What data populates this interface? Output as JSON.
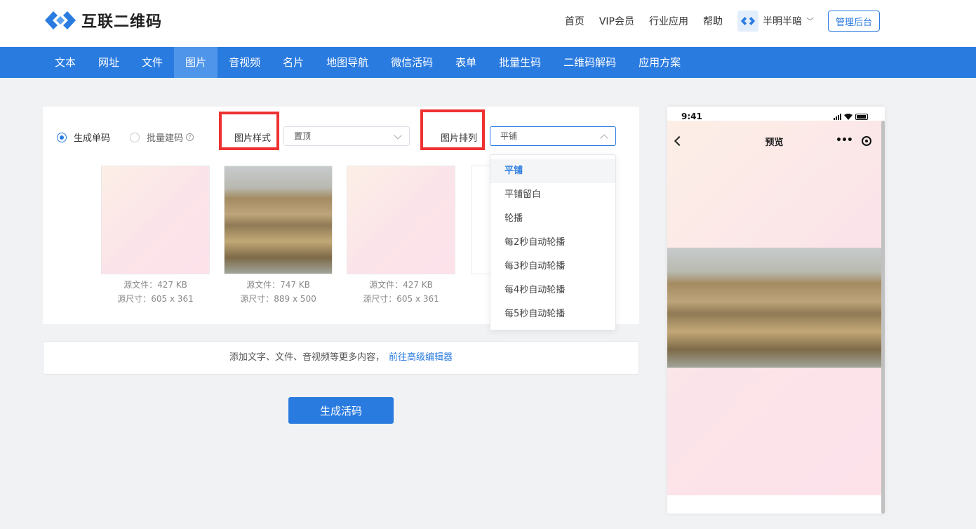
{
  "brand": {
    "name": "互联二维码"
  },
  "top_links": [
    "首页",
    "VIP会员",
    "行业应用",
    "帮助"
  ],
  "user": {
    "name": "半明半暗"
  },
  "admin_label": "管理后台",
  "nav": [
    "文本",
    "网址",
    "文件",
    "图片",
    "音视频",
    "名片",
    "地图导航",
    "微信活码",
    "表单",
    "批量生码",
    "二维码解码",
    "应用方案"
  ],
  "nav_active": "图片",
  "mode": {
    "single": "生成单码",
    "batch": "批量建码",
    "help": "?"
  },
  "style_field": {
    "label": "图片样式",
    "value": "置顶"
  },
  "arrange_field": {
    "label": "图片排列",
    "value": "平铺"
  },
  "thumbs": [
    {
      "size": "源文件：427 KB",
      "dims": "源尺寸：605 x 361"
    },
    {
      "size": "源文件：747 KB",
      "dims": "源尺寸：889 x 500"
    },
    {
      "size": "源文件：427 KB",
      "dims": "源尺寸：605 x 361"
    }
  ],
  "dropdown": [
    "平铺",
    "平铺留白",
    "轮播",
    "每2秒自动轮播",
    "每3秒自动轮播",
    "每4秒自动轮播",
    "每5秒自动轮播"
  ],
  "addbar": {
    "text": "添加文字、文件、音视频等更多内容，",
    "link": "前往高级编辑器"
  },
  "generate_label": "生成活码",
  "phone": {
    "time": "9:41",
    "title": "预览",
    "more": "•••"
  },
  "colors": {
    "primary": "#2a7be0",
    "highlight": "#ee3232"
  }
}
